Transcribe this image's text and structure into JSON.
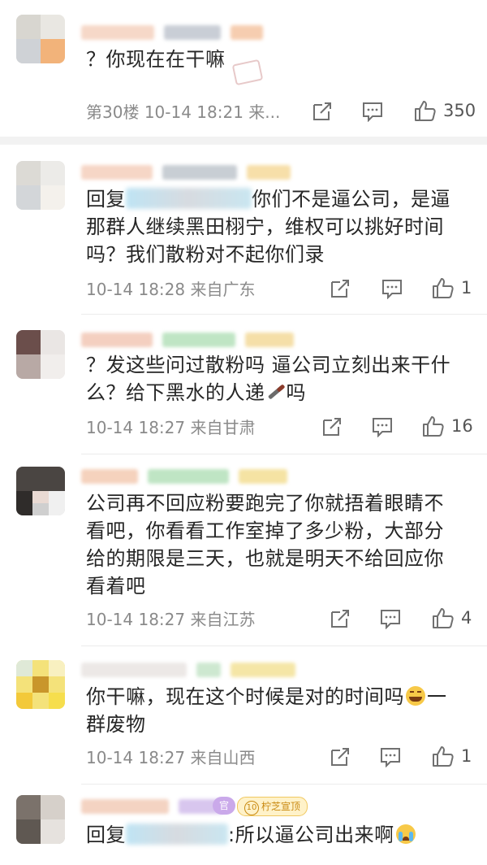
{
  "comments": [
    {
      "text": "？你现在在干嘛",
      "floor": "第30楼",
      "time": "10-14 18:21",
      "location": "来...",
      "likes": "350"
    },
    {
      "reply_prefix": "回复",
      "reply_tail": "你们不是逼公司，是逼",
      "line2": "那群人继续黑田栩宁，维权可以挑好时间",
      "line3": "吗？我们散粉对不起你们录",
      "time": "10-14 18:28",
      "location": "来自广东",
      "likes": "1"
    },
    {
      "line1": "？发这些问过散粉吗 逼公司立刻出来干什",
      "line2": "么？给下黑水的人递",
      "line2_tail": "吗",
      "time": "10-14 18:27",
      "location": "来自甘肃",
      "likes": "16"
    },
    {
      "line1": "公司再不回应粉要跑完了你就捂着眼睛不",
      "line2": "看吧，你看看工作室掉了多少粉，大部分",
      "line3": "给的期限是三天，也就是明天不给回应你",
      "line4": "看着吧",
      "time": "10-14 18:27",
      "location": "来自江苏",
      "likes": "4"
    },
    {
      "line1": "你干嘛，现在这个时候是对的时间吗",
      "line1_tail": "一",
      "line2": "群废物",
      "time": "10-14 18:27",
      "location": "来自山西",
      "likes": "1"
    },
    {
      "reply_prefix": "回复",
      "reply_tail": ":所以逼公司出来啊",
      "badge1": "官",
      "badge2": "柠芝宣顶",
      "badge2_level": "10"
    }
  ],
  "icons": {
    "share": "share-icon",
    "comment": "comment-icon",
    "like": "thumbs-up-icon",
    "laugh": "laughing-emoji-icon",
    "knife": "knife-emoji-icon",
    "cry": "crying-emoji-icon"
  },
  "colors": {
    "text": "#262626",
    "meta": "#8a8a8a",
    "divider": "#f2f2f2"
  }
}
